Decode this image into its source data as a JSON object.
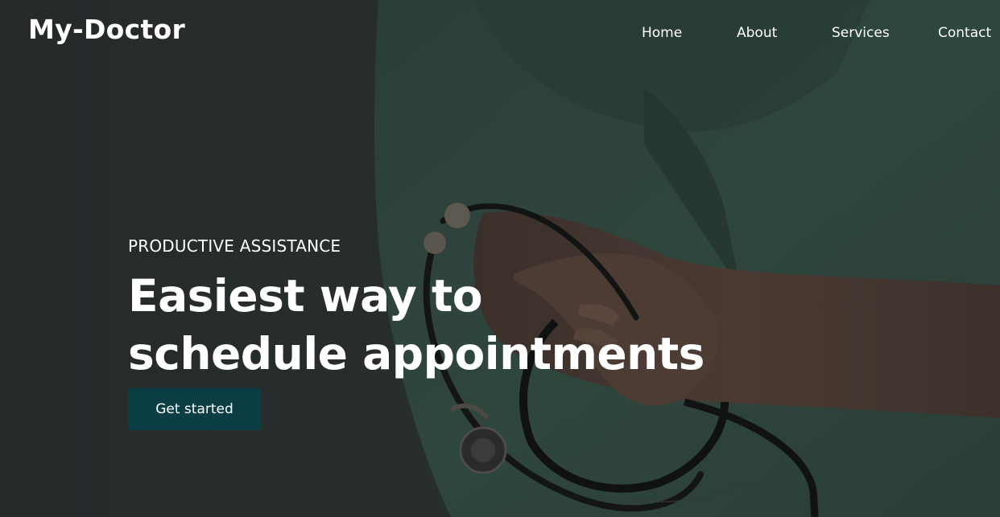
{
  "brand": {
    "logo_text": "My-Doctor"
  },
  "nav": {
    "items": [
      {
        "label": "Home"
      },
      {
        "label": "About"
      },
      {
        "label": "Services"
      },
      {
        "label": "Contact"
      }
    ]
  },
  "hero": {
    "eyebrow": "PRODUCTIVE ASSISTANCE",
    "headline_line1": "Easiest way to",
    "headline_line2": "schedule appointments",
    "cta_label": "Get started",
    "background_description_icon": "doctor-stethoscope-photo"
  },
  "colors": {
    "overlay": "#262a2b",
    "scrubs": "#2f4a41",
    "cta_background": "#0a3d44",
    "text": "#ffffff"
  }
}
